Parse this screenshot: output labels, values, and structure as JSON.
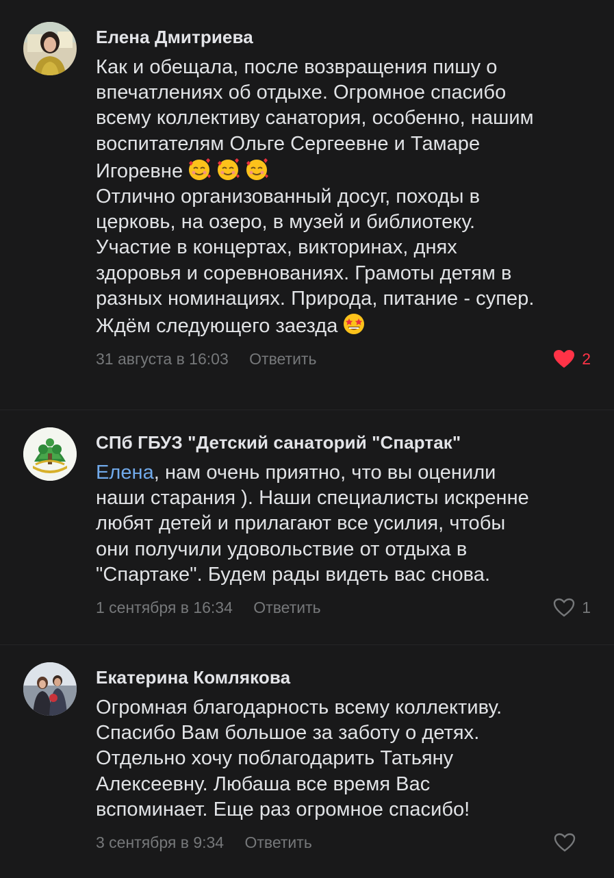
{
  "comments": [
    {
      "author": "Елена Дмитриева",
      "avatar": "user-photo-avatar",
      "lines": [
        "Как и обещала, после возвращения пишу о",
        "впечатлениях об отдыхе. Огромное спасибо",
        "всему коллективу санатория, особенно, нашим",
        "воспитателям Ольге Сергеевне и Тамаре",
        "Игоревне",
        "Отлично организованный досуг, походы в",
        "церковь, на озеро, в музей и библиотеку.",
        "Участие в концертах, викторинах, днях",
        "здоровья и соревнованиях. Грамоты детям в",
        "разных номинациях. Природа, питание - супер.",
        "Ждём следующего заезда"
      ],
      "emoji_after_line_5": [
        "smiling-face-with-hearts-emoji",
        "smiling-face-with-hearts-emoji",
        "smiling-face-with-hearts-emoji"
      ],
      "emoji_after_line_11": [
        "star-struck-emoji"
      ],
      "date": "31 августа в 16:03",
      "reply_label": "Ответить",
      "likes": "2",
      "liked": true
    },
    {
      "author": "СПб ГБУЗ \"Детский санаторий \"Спартак\"",
      "avatar": "sanatorium-logo-avatar",
      "mention": "Елена",
      "lines": [
        ", нам очень приятно, что вы оценили",
        "наши старания ). Наши специалисты искренне",
        "любят детей и прилагают все усилия, чтобы",
        "они получили удовольствие от отдыха в",
        "\"Спартаке\". Будем рады видеть вас снова."
      ],
      "date": "1 сентября в 16:34",
      "reply_label": "Ответить",
      "likes": "1",
      "liked": false
    },
    {
      "author": "Екатерина Комлякова",
      "avatar": "user-photo-avatar",
      "lines": [
        "Огромная благодарность всему коллективу.",
        "Спасибо Вам большое за заботу о детях.",
        "Отдельно хочу поблагодарить Татьяну",
        "Алексеевну. Любаша все время Вас",
        "вспоминает. Еще раз огромное спасибо!"
      ],
      "date": "3 сентября в 9:34",
      "reply_label": "Ответить",
      "likes": "",
      "liked": false
    }
  ],
  "colors": {
    "background": "#19191a",
    "text": "#e1e3e6",
    "secondary": "#76787a",
    "mention": "#71aaeb",
    "like_active": "#ff3347"
  }
}
